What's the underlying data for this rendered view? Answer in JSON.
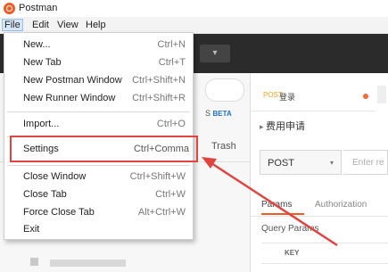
{
  "app": {
    "title": "Postman",
    "accent": "#ef5b25"
  },
  "menubar": {
    "items": [
      "File",
      "Edit",
      "View",
      "Help"
    ]
  },
  "file_menu": {
    "items": [
      {
        "label": "New...",
        "shortcut": "Ctrl+N"
      },
      {
        "label": "New Tab",
        "shortcut": "Ctrl+T"
      },
      {
        "label": "New Postman Window",
        "shortcut": "Ctrl+Shift+N"
      },
      {
        "label": "New Runner Window",
        "shortcut": "Ctrl+Shift+R"
      },
      {
        "label": "Import...",
        "shortcut": "Ctrl+O"
      },
      {
        "label": "Settings",
        "shortcut": "Ctrl+Comma"
      },
      {
        "label": "Close Window",
        "shortcut": "Ctrl+Shift+W"
      },
      {
        "label": "Close Tab",
        "shortcut": "Ctrl+W"
      },
      {
        "label": "Force Close Tab",
        "shortcut": "Alt+Ctrl+W"
      },
      {
        "label": "Exit",
        "shortcut": ""
      }
    ],
    "highlight_color": "#e0443f"
  },
  "sidebar": {
    "partial_tab": "S",
    "beta_badge": "BETA",
    "trash_label": "Trash"
  },
  "toolbar": {
    "dropdown_glyph": "▾"
  },
  "request": {
    "tab_method": "POST",
    "tab_name": "登录",
    "title": "费用申请",
    "method": "POST",
    "method_caret": "▾",
    "url_placeholder": "Enter re",
    "tabs": {
      "params": "Params",
      "authorization": "Authorization"
    },
    "query_params_label": "Query Params",
    "key_header": "KEY"
  }
}
